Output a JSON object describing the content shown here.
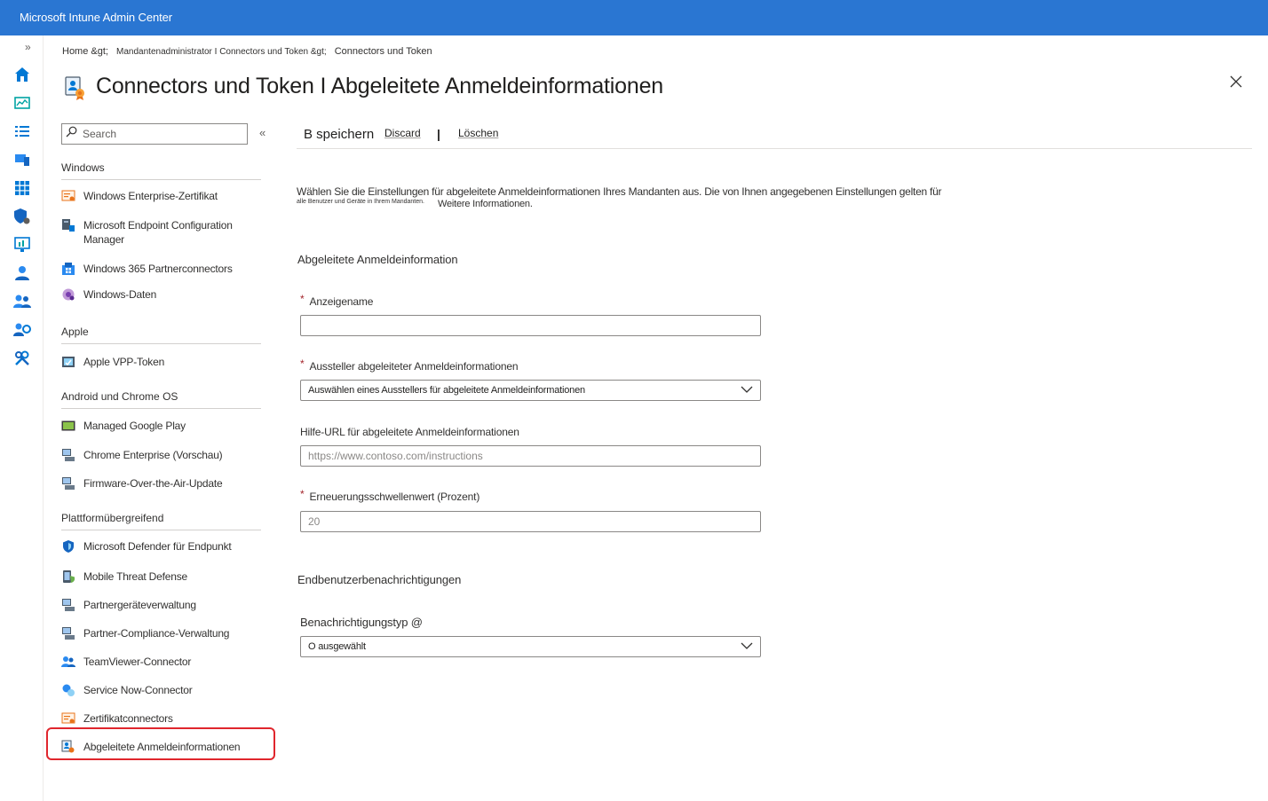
{
  "app": {
    "title": "Microsoft Intune Admin Center"
  },
  "rail": {
    "expand_label": "»",
    "icons": [
      "home-icon",
      "dashboard-icon",
      "all-services-icon",
      "devices-icon",
      "apps-icon",
      "endpoint-security-icon",
      "reports-icon",
      "users-icon",
      "groups-icon",
      "tenant-admin-icon",
      "troubleshooting-icon"
    ]
  },
  "breadcrumb": {
    "home": "Home &gt;",
    "tenant": "Mandantenadministrator I Connectors und Token &gt;",
    "current": "Connectors und Token"
  },
  "page": {
    "title": "Connectors und Token I Abgeleitete Anmeldeinformationen"
  },
  "search": {
    "placeholder": "Search",
    "collapse_label": "«"
  },
  "nav": {
    "groups": {
      "windows": "Windows",
      "apple": "Apple",
      "android": "Android und Chrome OS",
      "cross": "Plattformübergreifend"
    },
    "items": {
      "windows_enterprise": "Windows Enterprise-Zertifikat",
      "mecm_line1": "Microsoft Endpoint Configuration",
      "mecm_line2": "Manager",
      "w365": "Windows 365 Partnerconnectors",
      "windows_data": "Windows-Daten",
      "apple_vpp": "Apple VPP-Token",
      "google_play": "Managed Google Play",
      "chrome_enterprise": "Chrome Enterprise (Vorschau)",
      "fota": "Firmware-Over-the-Air-Update",
      "defender": "Microsoft Defender für Endpunkt",
      "mtd": "Mobile Threat Defense",
      "partner_device": "Partnergeräteverwaltung",
      "partner_compliance": "Partner-Compliance-Verwaltung",
      "teamviewer": "TeamViewer-Connector",
      "servicenow": "Service Now-Connector",
      "cert_connectors": "Zertifikatconnectors",
      "derived_creds": "Abgeleitete Anmeldeinformationen"
    }
  },
  "toolbar": {
    "save": "B speichern",
    "discard": "Discard",
    "separator": "|",
    "delete": "Löschen"
  },
  "content": {
    "description": "Wählen Sie die Einstellungen für abgeleitete Anmeldeinformationen Ihres Mandanten aus. Die von Ihnen angegebenen Einstellungen gelten für",
    "description_small": "alle Benutzer und Geräte in Ihrem Mandanten.",
    "more_info": "Weitere Informationen.",
    "section1": "Abgeleitete Anmeldeinformation",
    "section2": "Endbenutzerbenachrichtigungen",
    "fields": {
      "display_name": {
        "label": "Anzeigename",
        "required_mark": "*",
        "value": ""
      },
      "issuer": {
        "label": "Aussteller abgeleiteter Anmeldeinformationen",
        "required_mark": "*",
        "value": "Auswählen eines Ausstellers für abgeleitete Anmeldeinformationen"
      },
      "help_url": {
        "label": "Hilfe-URL für abgeleitete Anmeldeinformationen",
        "placeholder": "https://www.contoso.com/instructions"
      },
      "renewal": {
        "label": "Erneuerungsschwellenwert (Prozent)",
        "required_mark": "*",
        "placeholder": "20"
      },
      "notification": {
        "label": "Benachrichtigungstyp @",
        "value": "O ausgewählt"
      }
    }
  },
  "colors": {
    "topbar": "#2a76d2",
    "accent": "#0078d4",
    "selected_outline": "#e0262d",
    "required": "#a4262c"
  }
}
